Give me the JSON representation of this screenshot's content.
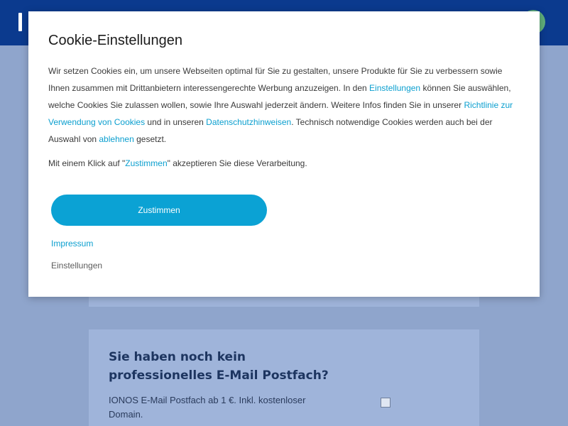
{
  "modal": {
    "title": "Cookie-Einstellungen",
    "body": {
      "t1": "Wir setzen Cookies ein, um unsere Webseiten optimal für Sie zu gestalten, unsere Produkte für Sie zu verbessern sowie Ihnen zusammen mit Drittanbietern interessengerechte Werbung anzuzeigen. In den ",
      "link_einstellungen": "Einstellungen",
      "t2": " können Sie auswählen, welche Cookies Sie zulassen wollen, sowie Ihre Auswahl jederzeit ändern. Weitere Infos finden Sie in unserer ",
      "link_richtlinie": "Richtlinie zur Verwendung von Cookies",
      "t3": " und in unseren ",
      "link_datenschutz": "Datenschutzhinweisen",
      "t4": ". Technisch notwendige Cookies werden auch bei der Auswahl von ",
      "link_ablehnen": "ablehnen",
      "t5": " gesetzt."
    },
    "consent": {
      "t1": "Mit einem Klick auf \"",
      "link_zustimmen": "Zustimmen",
      "t2": "\" akzeptieren Sie diese Verarbeitung."
    },
    "accept_label": "Zustimmen",
    "impressum_label": "Impressum",
    "settings_label": "Einstellungen"
  },
  "promo": {
    "title": "Sie haben noch kein professionelles E-Mail Postfach?",
    "text": "IONOS E-Mail Postfach ab 1 €. Inkl. kostenloser Domain."
  },
  "colors": {
    "header": "#0b3a8e",
    "overlay_background": "#8fa5cc",
    "link": "#0b9fcf",
    "accept_button": "#0ba2d4"
  }
}
